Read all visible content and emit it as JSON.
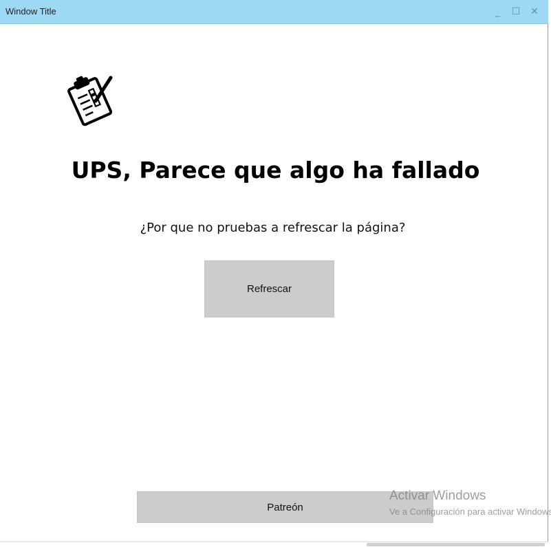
{
  "window": {
    "title": "Window Title",
    "controls": {
      "minimize_glyph": "_",
      "maximize_glyph": "☐",
      "close_glyph": "✕"
    }
  },
  "main": {
    "icon": "clipboard-checklist-icon",
    "heading": "UPS, Parece que algo ha fallado",
    "subtext": "¿Por que no pruebas a refrescar la página?",
    "refresh_label": "Refrescar",
    "patreon_label": "Patreón"
  },
  "watermark": {
    "title": "Activar Windows",
    "subtitle": "Ve a Configuración para activar Windows."
  },
  "colors": {
    "title_bar": "#9dd8f5",
    "button": "#cccccc",
    "background": "#ffffff"
  }
}
